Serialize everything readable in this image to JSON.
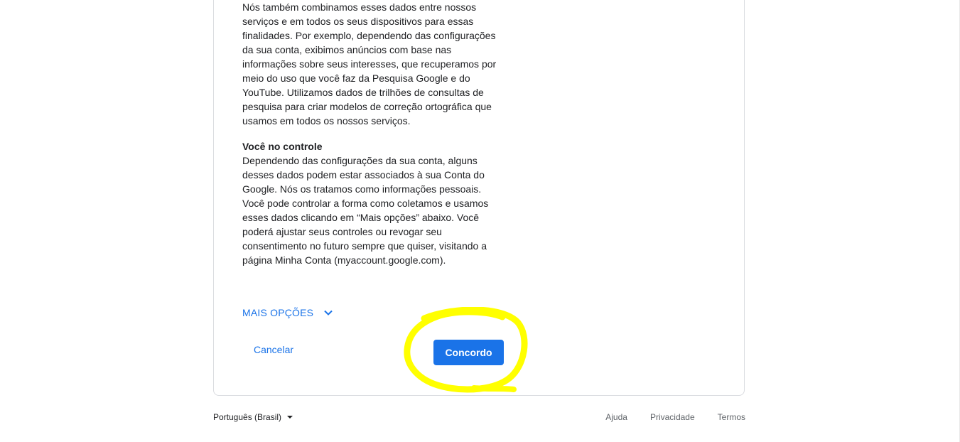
{
  "consent": {
    "paragraph_1": "Nós também combinamos esses dados entre nossos\nserviços e em todos os seus dispositivos para essas\nfinalidades. Por exemplo, dependendo das configurações\nda sua conta, exibimos anúncios com base nas\ninformações sobre seus interesses, que recuperamos por\nmeio do uso que você faz da Pesquisa Google e do\nYouTube. Utilizamos dados de trilhões de consultas de\npesquisa para criar modelos de correção ortográfica que\nusamos em todos os nossos serviços.",
    "heading_control": "Você no controle",
    "paragraph_2": "Dependendo das configurações da sua conta, alguns\ndesses dados podem estar associados à sua Conta do\nGoogle. Nós os tratamos como informações pessoais.\nVocê pode controlar a forma como coletamos e usamos\nesses dados clicando em “Mais opções” abaixo. Você\npoderá ajustar seus controles ou revogar seu\nconsentimento no futuro sempre que quiser, visitando a\npágina Minha Conta (myaccount.google.com).",
    "more_options_label": "MAIS OPÇÕES",
    "cancel_label": "Cancelar",
    "agree_label": "Concordo"
  },
  "footer": {
    "language": "Português (Brasil)",
    "links": [
      "Ajuda",
      "Privacidade",
      "Termos"
    ]
  },
  "icons": {
    "more_options": "chevron-down-icon",
    "language": "caret-down-icon"
  },
  "colors": {
    "accent": "#1a73e8",
    "highlight": "#ffff00",
    "border": "#dadce0"
  }
}
